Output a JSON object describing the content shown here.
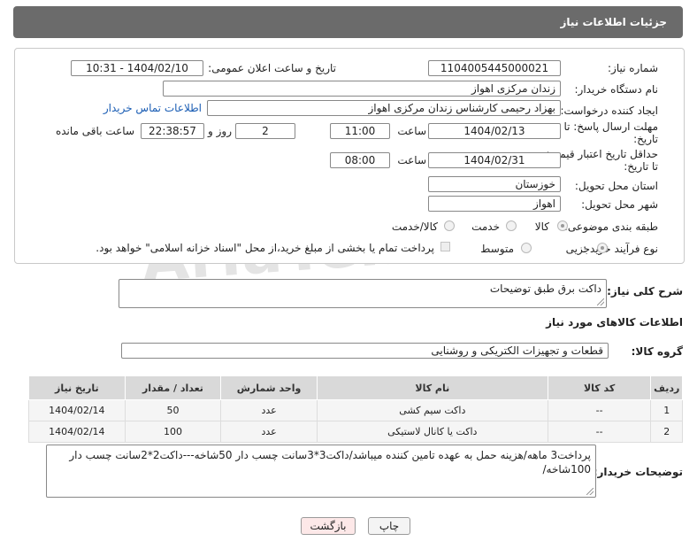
{
  "page": {
    "title": "جزئیات اطلاعات نیاز"
  },
  "form": {
    "need_number": {
      "label": "شماره نیاز:",
      "value": "1104005445000021"
    },
    "announce_datetime": {
      "label": "تاریخ و ساعت اعلان عمومی:",
      "value": "1404/02/10 - 10:31"
    },
    "buyer_org": {
      "label": "نام دستگاه خریدار:",
      "value": "زندان مرکزی اهواز"
    },
    "requester": {
      "label": "ایجاد کننده درخواست:",
      "value": "بهزاد رحیمی کارشناس زندان مرکزی اهواز",
      "contact_link": "اطلاعات تماس خریدار"
    },
    "reply_deadline": {
      "label_line1": "مهلت ارسال پاسخ: تا",
      "label_line2": "تاریخ:",
      "date": "1404/02/13",
      "time_label": "ساعت",
      "time": "11:00",
      "days": "2",
      "days_label": "روز و",
      "remaining": "22:38:57",
      "remaining_label": "ساعت باقی مانده"
    },
    "price_validity": {
      "label_line1": "حداقل تاریخ اعتبار قیمت:",
      "label_line2": "تا تاریخ:",
      "date": "1404/02/31",
      "time_label": "ساعت",
      "time": "08:00"
    },
    "province": {
      "label": "استان محل تحویل:",
      "value": "خوزستان"
    },
    "city": {
      "label": "شهر محل تحویل:",
      "value": "اهواز"
    },
    "category": {
      "label": "طبقه بندی موضوعی:",
      "options": [
        "کالا",
        "خدمت",
        "کالا/خدمت"
      ],
      "selected": "کالا"
    },
    "process_type": {
      "label": "نوع فرآیند خرید :",
      "options": [
        "جزیی",
        "متوسط"
      ],
      "selected": "جزیی",
      "payment_note": "پرداخت تمام یا بخشی از مبلغ خرید،از محل \"اسناد خزانه اسلامی\" خواهد بود."
    }
  },
  "summary": {
    "label": "شرح کلی نیاز:",
    "value": "داکت برق طبق توضیحات"
  },
  "goods_section": {
    "title": "اطلاعات کالاهای مورد نیاز"
  },
  "goods_group": {
    "label": "گروه کالا:",
    "value": "قطعات و تجهیزات الکتریکی و روشنایی"
  },
  "table": {
    "headers": [
      "ردیف",
      "کد کالا",
      "نام کالا",
      "واحد شمارش",
      "تعداد / مقدار",
      "تاریخ نیاز"
    ],
    "rows": [
      [
        "1",
        "--",
        "داکت سیم کشی",
        "عدد",
        "50",
        "1404/02/14"
      ],
      [
        "2",
        "--",
        "داکت یا کانال لاستیکی",
        "عدد",
        "100",
        "1404/02/14"
      ]
    ]
  },
  "buyer_notes": {
    "label": "توضیحات خریدار:",
    "value": "پرداخت3 ماهه/هزینه حمل به عهده تامین کننده میباشد/داکت3*3سانت چسب دار 50شاخه---داکت2*2سانت چسب دار 100شاخه/"
  },
  "buttons": {
    "print": "چاپ",
    "back": "بازگشت"
  },
  "watermark": {
    "text": "AriaTender.neT"
  },
  "colors": {
    "titlebar": "#6b6b6b",
    "link": "#1a5db4",
    "back_button": "#fde8e8"
  }
}
